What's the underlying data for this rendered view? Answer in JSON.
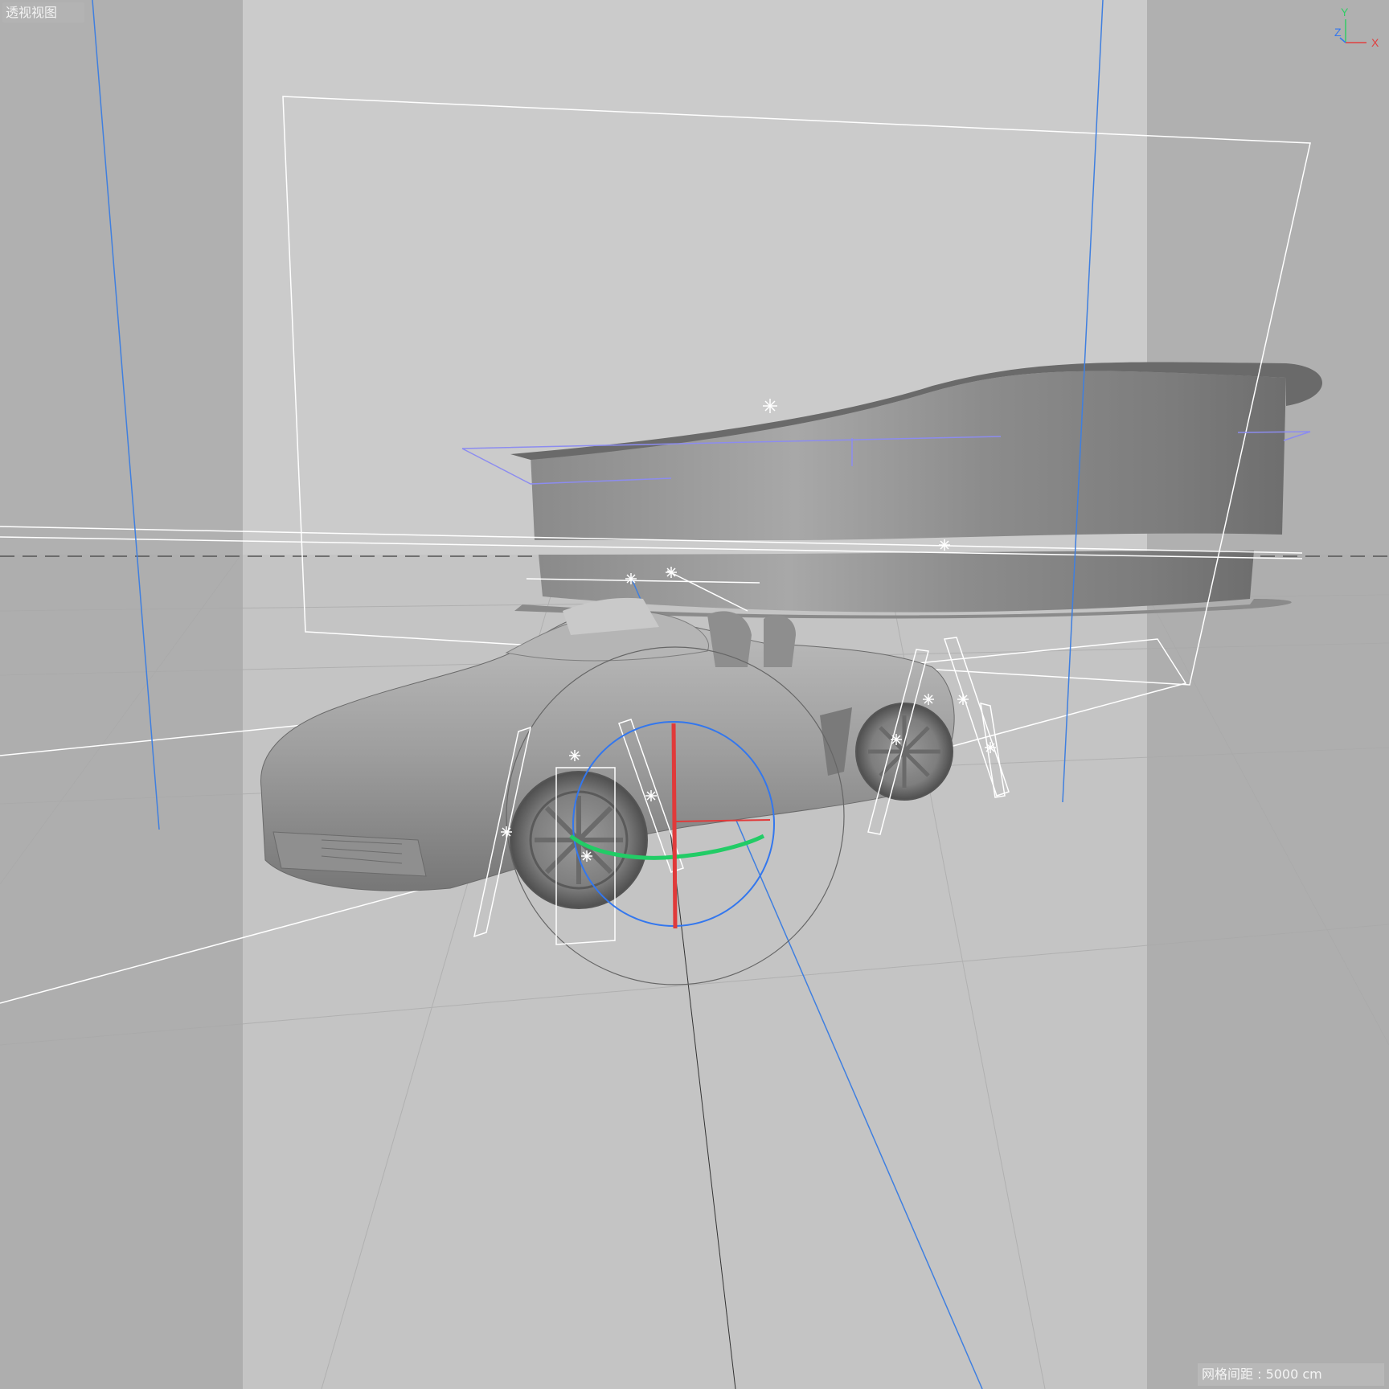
{
  "viewport": {
    "view_name": "透视视图",
    "grid_spacing": "网格间距 : 5000 cm"
  },
  "axis_gizmo": {
    "y_label": "Y",
    "z_label": "Z",
    "x_label": "X",
    "y_color": "#33cc66",
    "z_color": "#3377ee",
    "x_color": "#e04040"
  },
  "colors": {
    "background": "#cbcbcb",
    "safe_frame_shade": "#a9a9a9",
    "gizmo_x": "#e03a3a",
    "gizmo_y": "#22cc66",
    "gizmo_z": "#3377ee",
    "guide_blue": "#3f7fe0",
    "wire_white": "#ffffff"
  }
}
